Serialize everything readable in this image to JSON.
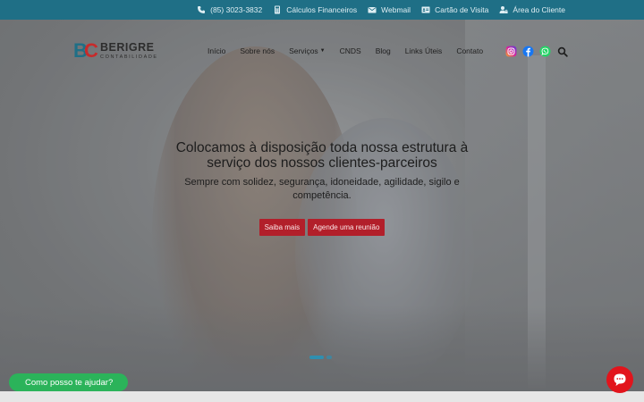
{
  "topbar": {
    "phone": "(85) 3023-3832",
    "calc": "Cálculos Financeiros",
    "webmail": "Webmail",
    "card": "Cartão de Visita",
    "client": "Área do Cliente"
  },
  "logo": {
    "mark_b": "B",
    "mark_c": "C",
    "name": "BERIGRE",
    "tagline": "CONTABILIDADE"
  },
  "nav": {
    "items": [
      "Início",
      "Sobre nós",
      "Serviços",
      "CNDS",
      "Blog",
      "Links Úteis",
      "Contato"
    ]
  },
  "hero": {
    "title": "Colocamos à disposição toda nossa estrutura à serviço dos nossos clientes-parceiros",
    "subtitle": "Sempre com solidez, segurança, idoneidade, agilidade, sigilo e competência.",
    "btn1": "Saiba mais",
    "btn2": "Agende uma reunião"
  },
  "chat": {
    "label": "Como posso te ajudar?"
  },
  "colors": {
    "topbar": "#1f6f86",
    "brand_red": "#b21f2a",
    "whatsapp": "#2bb35a",
    "chat_red": "#e2141c"
  },
  "icons": [
    "phone-icon",
    "calculator-icon",
    "mail-icon",
    "id-card-icon",
    "user-lock-icon",
    "instagram-icon",
    "facebook-icon",
    "whatsapp-icon",
    "search-icon",
    "chat-icon"
  ]
}
